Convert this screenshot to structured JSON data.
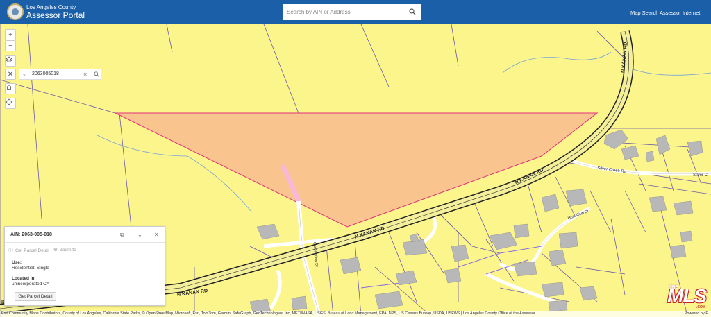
{
  "header": {
    "org": "Los Angeles County",
    "title": "Assessor Portal",
    "search_placeholder": "Search by AIN or Address",
    "links": [
      "Map Search",
      "Assessor Internet"
    ]
  },
  "tools": {
    "zoom_in": "+",
    "zoom_out": "−",
    "close": "✕"
  },
  "search_widget": {
    "value": "2063005018"
  },
  "map_labels": {
    "road_main": "N KANAN RD",
    "road_silver": "Silver Creek Rd",
    "road_silver_short": "Silver C",
    "road_castle": "Castle View Dr",
    "road_hunt": "Hunt Club Dr",
    "road_kanan_edge": "K"
  },
  "popup": {
    "title": "AIN: 2063-005-018",
    "action_detail": "Get Parcel Detail",
    "action_zoom": "Zoom to",
    "use_label": "Use:",
    "use_value": "Residential: Single",
    "location_label": "Located in:",
    "location_value": "unincorporated CA",
    "button": "Get Parcel Detail"
  },
  "attribution": "Esri Community Maps Contributors, County of Los Angeles, California State Parks, © OpenStreetMap, Microsoft, Esri, TomTom, Garmin, SafeGraph, GeoTechnologies, Inc, METI/NASA, USGS, Bureau of Land Management, EPA, NPS, US Census Bureau, USDA, USFWS | Los Angeles County Office of the Assessor",
  "powered_by": "Powered by E",
  "watermark": {
    "the": "THE",
    "mls": "MLS",
    "com": ".COM"
  },
  "colors": {
    "header": "#1a5fa8",
    "land": "#fbf58c",
    "parcel_selected": "#fac48e",
    "parcel_outline": "#e0307a",
    "road": "#f3ef9a",
    "lines": "#6b58a8"
  }
}
